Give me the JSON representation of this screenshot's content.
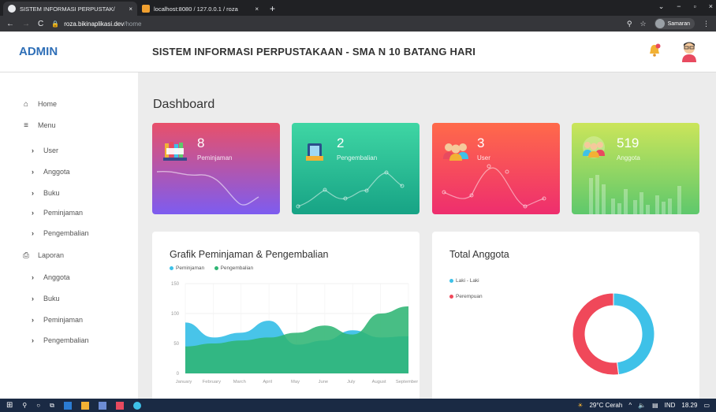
{
  "browser": {
    "tabs": [
      {
        "label": "SISTEM INFORMASI PERPUSTAK/",
        "close": "×"
      },
      {
        "label": "localhost:8080 / 127.0.0.1 / roza",
        "close": "×"
      }
    ],
    "new_tab": "+",
    "url_host": "roza.bikinaplikasi.dev",
    "url_path": "/home",
    "profile_name": "Samaran",
    "window_controls": [
      "⌄",
      "−",
      "▫",
      "×"
    ]
  },
  "header": {
    "brand": "ADMIN",
    "title": "SISTEM INFORMASI PERPUSTAKAAN - SMA N 10 BATANG HARI"
  },
  "sidebar": {
    "items": [
      {
        "icon": "home-icon",
        "label": "Home"
      },
      {
        "icon": "menu-icon",
        "label": "Menu"
      },
      {
        "label": "User"
      },
      {
        "label": "Anggota"
      },
      {
        "label": "Buku"
      },
      {
        "label": "Peminjaman"
      },
      {
        "label": "Pengembalian"
      },
      {
        "icon": "print-icon",
        "label": "Laporan"
      },
      {
        "label": "Anggota"
      },
      {
        "label": "Buku"
      },
      {
        "label": "Peminjaman"
      },
      {
        "label": "Pengembalian"
      }
    ]
  },
  "main": {
    "page_title": "Dashboard",
    "cards": [
      {
        "value": "8",
        "label": "Peminjaman",
        "icon": "books-icon",
        "color_from": "#e24b6c",
        "color_to": "#7b5cf0"
      },
      {
        "value": "2",
        "label": "Pengembalian",
        "icon": "book-return-icon",
        "color_from": "#3fd6a4",
        "color_to": "#16a085"
      },
      {
        "value": "3",
        "label": "User",
        "icon": "users-icon",
        "color_from": "#ff5e62",
        "color_to": "#f0306a"
      },
      {
        "value": "519",
        "label": "Anggota",
        "icon": "members-icon",
        "color_from": "#c5e45a",
        "color_to": "#5fc96b"
      }
    ]
  },
  "chart_data": [
    {
      "type": "area",
      "title": "Grafik Peminjaman & Pengembalian",
      "categories": [
        "January",
        "February",
        "March",
        "April",
        "May",
        "June",
        "July",
        "August",
        "September"
      ],
      "y_ticks": [
        "0",
        "50",
        "100",
        "150"
      ],
      "ylim": [
        0,
        150
      ],
      "legend_position": "top-left",
      "series": [
        {
          "name": "Peminjaman",
          "color": "#3ec1e8",
          "values": [
            85,
            60,
            68,
            88,
            48,
            55,
            72,
            60,
            62
          ]
        },
        {
          "name": "Pengembalian",
          "color": "#2fb574",
          "values": [
            45,
            50,
            55,
            60,
            68,
            80,
            65,
            100,
            112
          ]
        }
      ]
    },
    {
      "type": "pie",
      "title": "Total Anggota",
      "legend_position": "top-left",
      "labels": [
        "Laki - Laki",
        "Perempuan"
      ],
      "values": [
        48,
        52
      ],
      "colors": [
        "#3ec1e8",
        "#f0485a"
      ]
    }
  ],
  "taskbar": {
    "weather": "29°C Cerah",
    "lang": "IND",
    "time": "18.29"
  }
}
